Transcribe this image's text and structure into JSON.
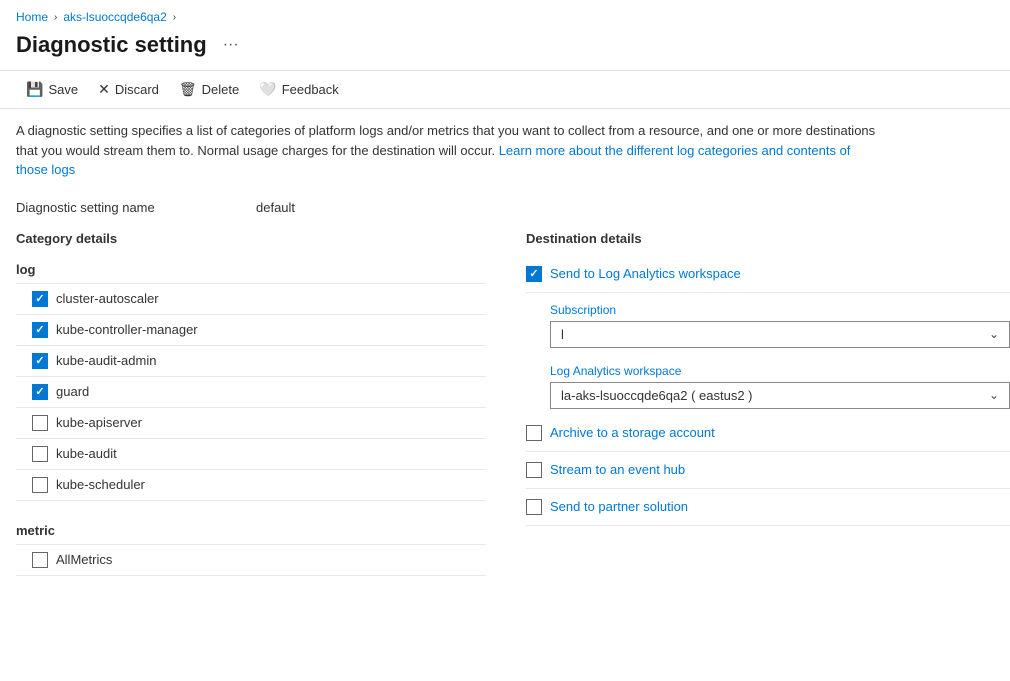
{
  "breadcrumb": {
    "home": "Home",
    "resource": "aks-lsuoccqde6qa2"
  },
  "page": {
    "title": "Diagnostic setting",
    "more_icon": "···"
  },
  "toolbar": {
    "save_label": "Save",
    "discard_label": "Discard",
    "delete_label": "Delete",
    "feedback_label": "Feedback"
  },
  "description": {
    "text1": "A diagnostic setting specifies a list of categories of platform logs and/or metrics that you want to collect from a resource, and one or more destinations that you would stream them to. Normal usage charges for the destination will occur. ",
    "link_text": "Learn more about the different log categories and contents of those logs",
    "text2": ""
  },
  "setting_name": {
    "label": "Diagnostic setting name",
    "value": "default"
  },
  "category_details": {
    "title": "Category details",
    "log_group": {
      "label": "log",
      "items": [
        {
          "name": "cluster-autoscaler",
          "checked": true
        },
        {
          "name": "kube-controller-manager",
          "checked": true
        },
        {
          "name": "kube-audit-admin",
          "checked": true
        },
        {
          "name": "guard",
          "checked": true
        },
        {
          "name": "kube-apiserver",
          "checked": false
        },
        {
          "name": "kube-audit",
          "checked": false
        },
        {
          "name": "kube-scheduler",
          "checked": false
        }
      ]
    },
    "metric_group": {
      "label": "metric",
      "items": [
        {
          "name": "AllMetrics",
          "checked": false
        }
      ]
    }
  },
  "destination_details": {
    "title": "Destination details",
    "send_to_analytics": {
      "label": "Send to Log Analytics workspace",
      "checked": true
    },
    "subscription": {
      "label": "Subscription",
      "value": "l",
      "placeholder": "l"
    },
    "log_analytics_workspace": {
      "label": "Log Analytics workspace",
      "value": "la-aks-lsuoccqde6qa2 ( eastus2 )"
    },
    "archive_storage": {
      "label": "Archive to a storage account",
      "checked": false
    },
    "stream_event_hub": {
      "label": "Stream to an event hub",
      "checked": false
    },
    "partner_solution": {
      "label": "Send to partner solution",
      "checked": false
    }
  }
}
